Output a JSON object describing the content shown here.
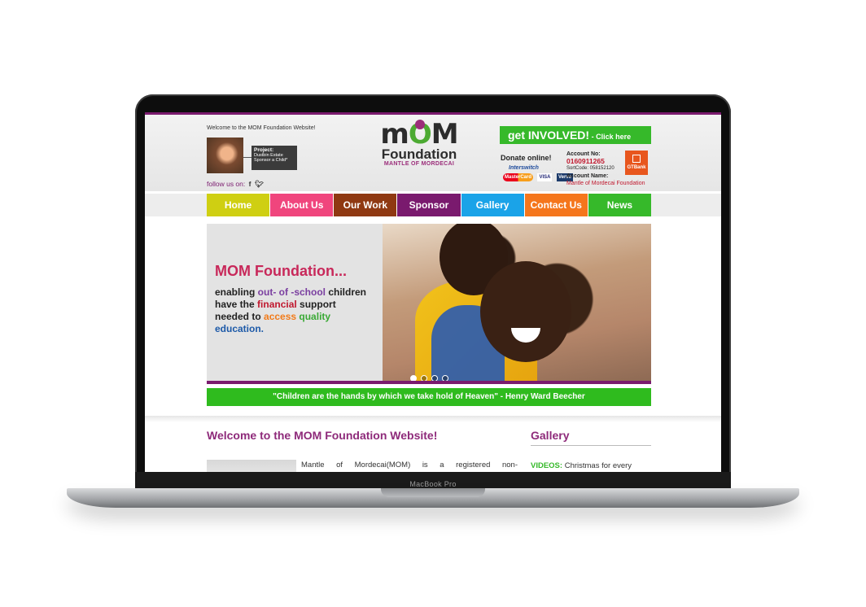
{
  "device": {
    "label": "MacBook Pro"
  },
  "header": {
    "welcome": "Welcome to the MOM Foundation Website!",
    "project": {
      "title": "Project:",
      "line1": "Dustbin Estate",
      "line2": "Sponsor a Child*"
    },
    "follow": "follow us on:",
    "social": {
      "facebook": "f",
      "twitter": "♦"
    }
  },
  "logo": {
    "mom_m1": "m",
    "mom_o": "O",
    "mom_m2": "M",
    "foundation": "Foundation",
    "tagline": "MANTLE OF MORDECAI"
  },
  "involved": {
    "big": "get INVOLVED!",
    "small": " - Click here"
  },
  "donate": {
    "label": "Donate online!",
    "interswitch": "Interswitch",
    "cards": [
      "MasterCard",
      "VISA",
      "Verve"
    ]
  },
  "account": {
    "no_label": "Account No:",
    "number": "0160911265",
    "sortcode": "SortCode: 058152120",
    "name_label": "Account Name:",
    "name": "Mantle of Mordecai Foundation",
    "bank": "GTBank"
  },
  "nav": [
    {
      "label": "Home",
      "color": "#cfcf12"
    },
    {
      "label": "About Us",
      "color": "#f0457d"
    },
    {
      "label": "Our Work",
      "color": "#8f3912"
    },
    {
      "label": "Sponsor",
      "color": "#7a1a6e"
    },
    {
      "label": "Gallery",
      "color": "#1aa3e8"
    },
    {
      "label": "Contact Us",
      "color": "#f5761c"
    },
    {
      "label": "News",
      "color": "#36b92a"
    }
  ],
  "slide": {
    "title": "MOM Foundation...",
    "l1a": "enabling ",
    "l1b": "out- of -school",
    "l1c": " children",
    "l2a": "have the ",
    "l2b": "financial",
    "l2c": " support",
    "l3a": "needed to ",
    "l3b": "access",
    "l3c": " quality",
    "l4": "education.",
    "dots": 4,
    "active_dot": 0
  },
  "quote": "\"Children are the hands by which we take hold of Heaven\" - Henry Ward Beecher",
  "main": {
    "welcome_heading": "Welcome to the MOM Foundation Website!",
    "body": "Mantle of Mordecai(MOM) is a registered non-"
  },
  "gallery": {
    "heading": "Gallery",
    "videos_label": "VIDEOS:",
    "videos_text": " Christmas for every"
  }
}
